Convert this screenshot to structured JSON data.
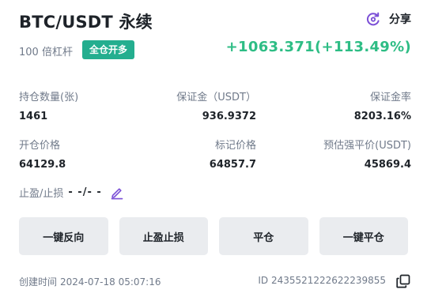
{
  "header": {
    "title": "BTC/USDT 永续",
    "share_label": "分享",
    "share_icon": "share-icon",
    "accent_color": "#7b4fd6"
  },
  "position": {
    "leverage": "100 倍杠杆",
    "margin_mode": "全仓开多",
    "pnl": "+1063.371(+113.49%)",
    "profit_color": "#2ebd85",
    "badge_color": "#24ae8f"
  },
  "fields": {
    "size_label": "持仓数量(张)",
    "size_value": "1461",
    "margin_label": "保证金（USDT）",
    "margin_value": "936.9372",
    "margin_ratio_label": "保证金率",
    "margin_ratio_value": "8203.16%",
    "entry_label": "开仓价格",
    "entry_value": "64129.8",
    "mark_label": "标记价格",
    "mark_value": "64857.7",
    "liq_label": "预估强平价(USDT)",
    "liq_value": "45869.4"
  },
  "tpsl": {
    "label": "止盈/止损",
    "value": "- -/- -",
    "edit_icon": "edit-icon"
  },
  "buttons": {
    "reverse": "一键反向",
    "tpsl": "止盈止损",
    "close": "平仓",
    "close_all": "一键平仓"
  },
  "footer": {
    "created_label": "创建时间",
    "created_time": "2024-07-18 05:07:16",
    "id_text": "ID 2435521222622239855",
    "copy_icon": "copy-icon"
  }
}
